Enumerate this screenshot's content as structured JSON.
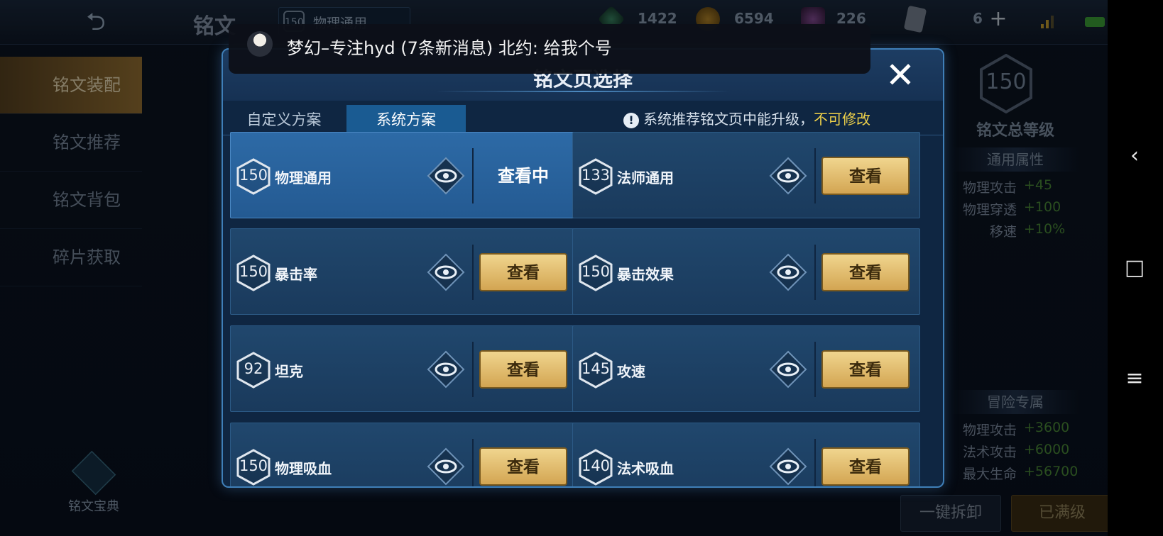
{
  "topbar": {
    "title": "铭文",
    "current_page_level": "150",
    "current_page_name": "物理通用",
    "currencies": [
      {
        "icon": "gem-icon",
        "value": "1422"
      },
      {
        "icon": "gold-coin-icon",
        "value": "6594"
      },
      {
        "icon": "crystal-icon",
        "value": "226"
      },
      {
        "icon": "card-icon",
        "value": "6"
      }
    ]
  },
  "sidebar": {
    "items": [
      {
        "label": "铭文装配"
      },
      {
        "label": "铭文推荐"
      },
      {
        "label": "铭文背包"
      },
      {
        "label": "碎片获取"
      }
    ],
    "codex_label": "铭文宝典"
  },
  "right_panel": {
    "total_level": "150",
    "total_level_label": "铭文总等级",
    "general_header": "通用属性",
    "general_attrs": [
      {
        "key": "物理攻击",
        "value": "+45"
      },
      {
        "key": "物理穿透",
        "value": "+100"
      },
      {
        "key": "移速",
        "value": "+10%"
      }
    ],
    "adventure_header": "冒险专属",
    "adventure_attrs": [
      {
        "key": "物理攻击",
        "value": "+3600"
      },
      {
        "key": "法术攻击",
        "value": "+6000"
      },
      {
        "key": "最大生命",
        "value": "+56700"
      }
    ],
    "unequip_label": "一键拆卸",
    "maxed_label": "已满级"
  },
  "notification": {
    "text": "梦幻–专注hyd (7条新消息) 北约: 给我个号"
  },
  "modal": {
    "title": "铭文页选择",
    "tabs": [
      {
        "label": "自定义方案"
      },
      {
        "label": "系统方案"
      }
    ],
    "notice": "系统推荐铭文页中能升级，",
    "notice_warn": "不可修改",
    "cards": [
      {
        "level": "150",
        "name": "物理通用",
        "action": "查看中"
      },
      {
        "level": "133",
        "name": "法师通用",
        "action": "查看"
      },
      {
        "level": "150",
        "name": "暴击率",
        "action": "查看"
      },
      {
        "level": "150",
        "name": "暴击效果",
        "action": "查看"
      },
      {
        "level": "92",
        "name": "坦克",
        "action": "查看"
      },
      {
        "level": "145",
        "name": "攻速",
        "action": "查看"
      },
      {
        "level": "150",
        "name": "物理吸血",
        "action": "查看"
      },
      {
        "level": "140",
        "name": "法术吸血",
        "action": "查看"
      }
    ]
  },
  "navbar": {
    "back_icon": "‹",
    "home_icon": "□",
    "menu_icon": "≡"
  },
  "colors": {
    "accent_blue": "#3f7fb8",
    "gold_button": "#d3a552",
    "warn_yellow": "#f0d24a",
    "attr_green": "#4e8f3a"
  }
}
